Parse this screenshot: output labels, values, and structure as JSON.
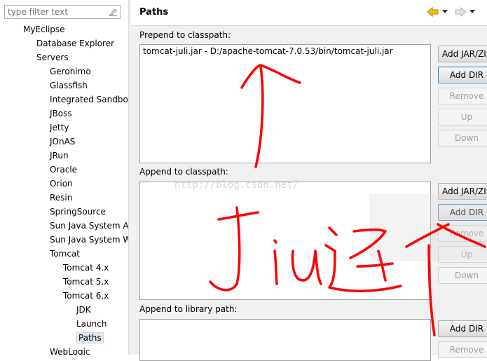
{
  "filter": {
    "placeholder": "type filter text"
  },
  "tree": [
    {
      "label": "MyEclipse",
      "level": 1
    },
    {
      "label": "Database Explorer",
      "level": 2
    },
    {
      "label": "Servers",
      "level": 2
    },
    {
      "label": "Geronimo",
      "level": 3
    },
    {
      "label": "Glassfish",
      "level": 3
    },
    {
      "label": "Integrated Sandbo",
      "level": 3
    },
    {
      "label": "JBoss",
      "level": 3
    },
    {
      "label": "Jetty",
      "level": 3
    },
    {
      "label": "JOnAS",
      "level": 3
    },
    {
      "label": "JRun",
      "level": 3
    },
    {
      "label": "Oracle",
      "level": 3
    },
    {
      "label": "Orion",
      "level": 3
    },
    {
      "label": "Resin",
      "level": 3
    },
    {
      "label": "SpringSource",
      "level": 3
    },
    {
      "label": "Sun Java System A",
      "level": 3
    },
    {
      "label": "Sun Java System W",
      "level": 3
    },
    {
      "label": "Tomcat",
      "level": 3
    },
    {
      "label": "Tomcat  4.x",
      "level": 4
    },
    {
      "label": "Tomcat  5.x",
      "level": 4
    },
    {
      "label": "Tomcat  6.x",
      "level": 4
    },
    {
      "label": "JDK",
      "level": 5
    },
    {
      "label": "Launch",
      "level": 5
    },
    {
      "label": "Paths",
      "level": 5,
      "selected": true
    },
    {
      "label": "WebLogic",
      "level": 3
    }
  ],
  "header": {
    "title": "Paths",
    "back_icon": "back-arrow-icon",
    "forward_icon": "forward-arrow-icon"
  },
  "sections": {
    "prepend": {
      "label": "Prepend to classpath:",
      "items": [
        "tomcat-juli.jar - D:/apache-tomcat-7.0.53/bin/tomcat-juli.jar"
      ]
    },
    "append": {
      "label": "Append to classpath:",
      "items": []
    },
    "library": {
      "label": "Append to library path:",
      "items": []
    }
  },
  "buttons": {
    "add_jar": "Add JAR/ZIP",
    "add_dir": "Add DIR",
    "remove": "Remove",
    "up": "Up",
    "down": "Down"
  },
  "watermark": "http://blog.csdn.net/",
  "annotation_text": "jiu这",
  "colors": {
    "annotation": "#ff0000",
    "accent": "#e8a000"
  }
}
